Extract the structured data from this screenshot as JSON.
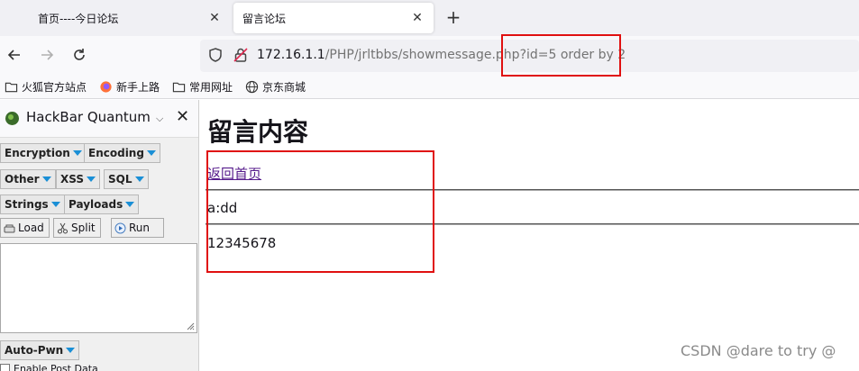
{
  "browser": {
    "tabs": [
      {
        "label": "首页----今日论坛",
        "active": false
      },
      {
        "label": "留言论坛",
        "active": true
      }
    ],
    "new_tab_label": "+",
    "url": {
      "host": "172.16.1.1",
      "path": "/PHP/jrltbbs/showmessage.php",
      "query": "?id=5 order by 2"
    },
    "bookmarks": [
      {
        "label": "火狐官方站点",
        "icon": "folder-icon"
      },
      {
        "label": "新手上路",
        "icon": "firefox-icon"
      },
      {
        "label": "常用网址",
        "icon": "folder-icon"
      },
      {
        "label": "京东商城",
        "icon": "globe-icon"
      }
    ]
  },
  "hackbar": {
    "title": "HackBar Quantum",
    "menus": {
      "encryption": "Encryption",
      "encoding": "Encoding",
      "other": "Other",
      "xss": "XSS",
      "sql": "SQL",
      "strings": "Strings",
      "payloads": "Payloads",
      "auto_pwn": "Auto-Pwn"
    },
    "tools": {
      "load": "Load",
      "split": "Split",
      "run": "Run"
    },
    "enable_post": "Enable Post Data"
  },
  "page": {
    "title": "留言内容",
    "back_link": "返回首页",
    "message_line": "a:dd",
    "content_line": "12345678"
  },
  "watermark": "CSDN @dare to try @",
  "colors": {
    "highlight": "#e01010",
    "link_visited": "#551a8b",
    "hackbar_arrow": "#1a8fd6"
  }
}
